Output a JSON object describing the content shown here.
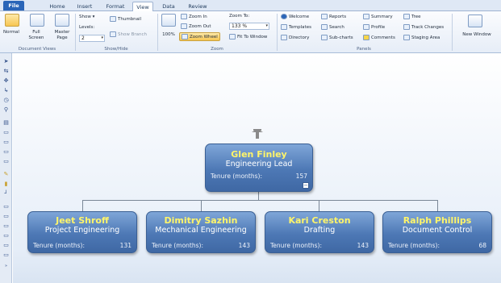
{
  "tabs": [
    "File",
    "Home",
    "Insert",
    "Format",
    "View",
    "Data",
    "Review"
  ],
  "active_tab": "View",
  "document_views": {
    "group_label": "Document Views",
    "normal": "Normal",
    "full_screen": "Full Screen",
    "master_page": "Master Page"
  },
  "show_hide": {
    "group_label": "Show/Hide",
    "show": "Show",
    "levels_label": "Levels:",
    "levels_value": "2",
    "thumbnail": "Thumbnail",
    "show_branch": "Show Branch"
  },
  "zoom": {
    "group_label": "Zoom",
    "zoom_100": "100%",
    "zoom_in": "Zoom In",
    "zoom_out": "Zoom Out",
    "zoom_wheel": "Zoom Wheel",
    "zoom_to_label": "Zoom To:",
    "zoom_to_value": "133 %",
    "fit_to_window": "Fit To Window"
  },
  "panels": {
    "group_label": "Panels",
    "welcome": "Welcome",
    "templates": "Templates",
    "directory": "Directory",
    "reports": "Reports",
    "search": "Search",
    "sub_charts": "Sub-charts",
    "summary": "Summary",
    "profile": "Profile",
    "comments": "Comments",
    "tree": "Tree",
    "track_changes": "Track Changes",
    "staging_area": "Staging Area"
  },
  "new_window": "New Window",
  "chart": {
    "root": {
      "name": "Glen Finley",
      "title": "Engineering Lead",
      "tenure_label": "Tenure (months):",
      "tenure": "157"
    },
    "children": [
      {
        "name": "Jeet Shroff",
        "title": "Project Engineering",
        "tenure_label": "Tenure (months):",
        "tenure": "131"
      },
      {
        "name": "Dimitry Sazhin",
        "title": "Mechanical Engineering",
        "tenure_label": "Tenure (months):",
        "tenure": "143"
      },
      {
        "name": "Kari Creston",
        "title": "Drafting",
        "tenure_label": "Tenure (months):",
        "tenure": "143"
      },
      {
        "name": "Ralph Phillips",
        "title": "Document Control",
        "tenure_label": "Tenure (months):",
        "tenure": "68"
      }
    ]
  },
  "colors": {
    "node_fill": "#4d78b5",
    "node_name": "#fff56a",
    "file_tab": "#2a65b8",
    "selection": "#f7c652"
  }
}
